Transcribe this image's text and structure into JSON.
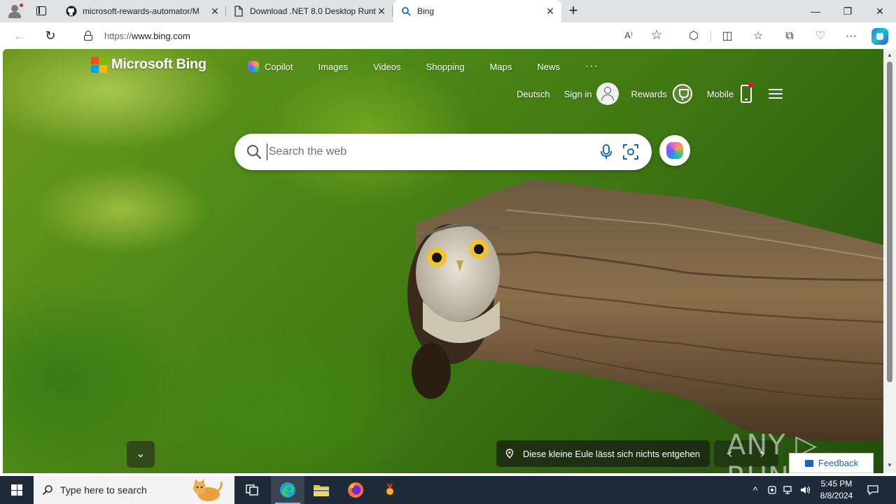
{
  "browser": {
    "tabs": [
      {
        "title": "microsoft-rewards-automator/M",
        "icon": "github-icon",
        "active": false
      },
      {
        "title": "Download .NET 8.0 Desktop Runt",
        "icon": "page-icon",
        "active": false
      },
      {
        "title": "Bing",
        "icon": "search-icon",
        "active": true
      }
    ],
    "new_tab_label": "+",
    "window_controls": {
      "minimize": "—",
      "restore": "❐",
      "close": "✕"
    },
    "address": {
      "protocol": "https://",
      "host": "www.bing.com"
    },
    "nav": {
      "back": "←",
      "refresh": "↻"
    },
    "toolbar_icons": {
      "read_aloud": "A⁾",
      "favorite": "☆",
      "extensions": "⬡",
      "split_screen": "◫",
      "favorites": "☆",
      "collections": "⧉",
      "performance": "♡",
      "more": "···"
    }
  },
  "bing": {
    "logo_text": "Microsoft Bing",
    "nav": [
      "Copilot",
      "Images",
      "Videos",
      "Shopping",
      "Maps",
      "News",
      "···"
    ],
    "language": "Deutsch",
    "sign_in": "Sign in",
    "rewards": "Rewards",
    "mobile": "Mobile",
    "search": {
      "placeholder": "Search the web",
      "value": ""
    },
    "scroll_down": "⌄",
    "caption": "Diese kleine Eule lässt sich nichts entgehen",
    "arrows": {
      "prev": "‹",
      "next": "›"
    },
    "watermark": "ANY ▷ RUN",
    "feedback": "Feedback"
  },
  "taskbar": {
    "search_placeholder": "Type here to search",
    "time": "5:45 PM",
    "date": "8/8/2024",
    "tray_chevron": "^"
  },
  "colors": {
    "ms_red": "#f25022",
    "ms_green": "#7fba00",
    "ms_blue": "#00a4ef",
    "ms_yellow": "#ffb900",
    "taskbar_bg": "#1f2b38",
    "tabstrip_bg": "#dfe1e5",
    "feedback_blue": "#1a63c6"
  }
}
